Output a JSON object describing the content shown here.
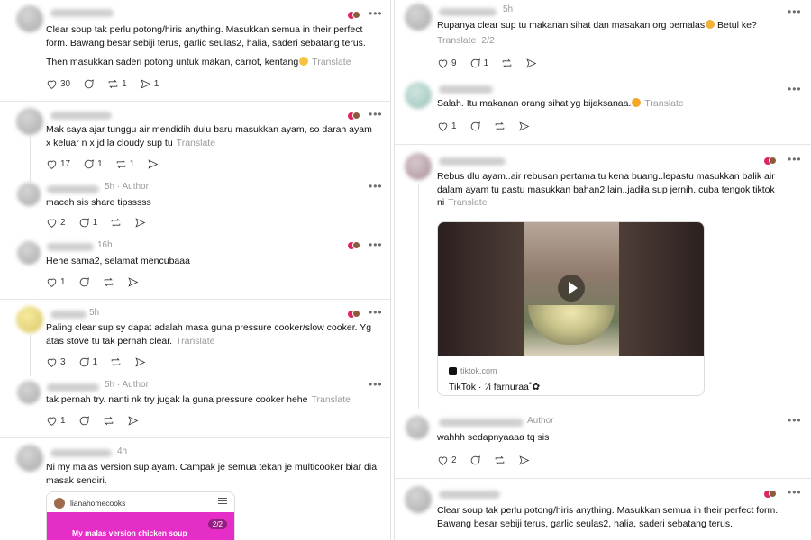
{
  "left": {
    "p1": {
      "text": "Clear soup tak perlu potong/hiris anything. Masukkan semua in their perfect form. Bawang besar sebiji terus, garlic seulas2, halia, saderi sebatang terus.",
      "text2": "Then masukkan saderi potong untuk makan, carrot, kentang",
      "translate": "Translate",
      "likes": "30",
      "reposts": "1",
      "shares": "1"
    },
    "p2": {
      "text": "Mak saya ajar tunggu air mendidih dulu baru masukkan ayam, so darah ayam x keluar n x jd la cloudy sup tu",
      "translate": "Translate",
      "likes": "17",
      "replies": "1",
      "reposts": "1"
    },
    "p3": {
      "meta": "5h · Author",
      "text": "maceh sis share tipsssss",
      "likes": "2",
      "replies": "1"
    },
    "p4": {
      "meta": "16h",
      "text": "Hehe sama2, selamat mencubaaa",
      "likes": "1"
    },
    "p5": {
      "meta": "5h",
      "text": "Paling clear sup sy dapat adalah masa guna pressure cooker/slow cooker. Yg atas stove tu tak pernah clear.",
      "translate": "Translate",
      "likes": "3",
      "replies": "1"
    },
    "p6": {
      "meta": "5h · Author",
      "text": "tak pernah try. nanti nk try jugak la guna pressure cooker hehe",
      "translate": "Translate",
      "likes": "1"
    },
    "p7": {
      "meta": "4h",
      "text": "Ni my malas version sup ayam. Campak je semua tekan je multicooker biar dia masak sendiri.",
      "embed_user": "lianahomecooks",
      "embed_page": "2/2",
      "embed_caption": "My malas version chicken soup"
    }
  },
  "right": {
    "r1": {
      "meta": "5h",
      "text": "Rupanya clear sup tu makanan sihat dan masakan org pemalas",
      "text_tail": " Betul ke?",
      "translate": "Translate",
      "page": "2/2",
      "likes": "9",
      "replies": "1"
    },
    "r2": {
      "text": "Salah. Itu makanan orang sihat yg bijaksanaa.",
      "translate": "Translate",
      "likes": "1"
    },
    "r3": {
      "text": "Rebus dlu ayam..air rebusan pertama tu kena buang..lepastu masukkan balik air dalam ayam tu pastu masukkan bahan2 lain..jadila sup jernih..cuba tengok tiktok ni",
      "translate": "Translate",
      "card_domain": "tiktok.com",
      "card_title": "TikTok · ʾ⁄i farnuraa˚✿"
    },
    "r4": {
      "meta": "Author",
      "text": "wahhh sedapnyaaaa tq sis",
      "likes": "2"
    },
    "r5": {
      "text": "Clear soup tak perlu potong/hiris anything. Masukkan semua in their perfect form. Bawang besar sebiji terus, garlic seulas2, halia, saderi sebatang terus."
    }
  },
  "icons": [
    "heart-icon",
    "reply-icon",
    "repost-icon",
    "share-icon",
    "more-icon",
    "play-icon"
  ]
}
